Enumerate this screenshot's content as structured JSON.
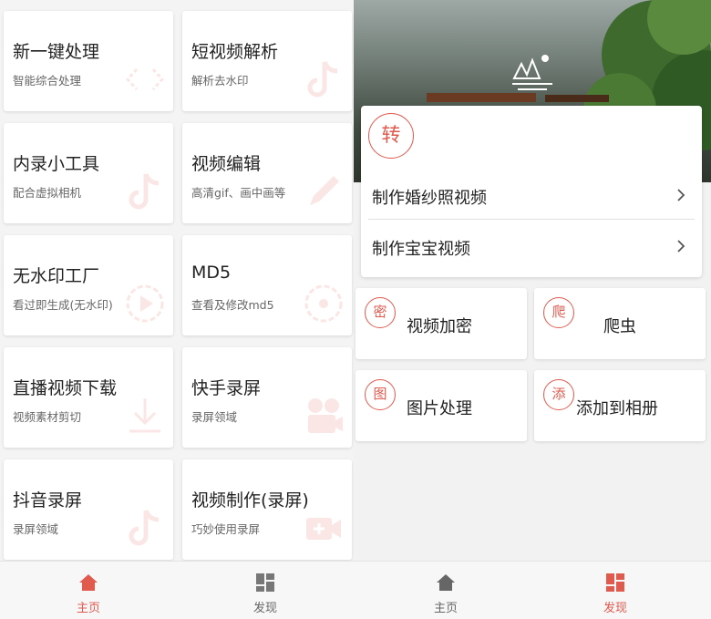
{
  "left": {
    "cards": [
      {
        "title": "新一键处理",
        "sub": "智能综合处理",
        "icon": "code-brackets-icon"
      },
      {
        "title": "短视频解析",
        "sub": "解析去水印",
        "icon": "tiktok-icon"
      },
      {
        "title": "内录小工具",
        "sub": "配合虚拟相机",
        "icon": "tiktok-icon"
      },
      {
        "title": "视频编辑",
        "sub": "高清gif、画中画等",
        "icon": "pencil-icon"
      },
      {
        "title": "无水印工厂",
        "sub": "看过即生成(无水印)",
        "icon": "play-circle-icon"
      },
      {
        "title": "MD5",
        "sub": "查看及修改md5",
        "icon": "target-icon"
      },
      {
        "title": "直播视频下载",
        "sub": "视频素材剪切",
        "icon": "download-icon"
      },
      {
        "title": "快手录屏",
        "sub": "录屏领域",
        "icon": "camera-reel-icon"
      },
      {
        "title": "抖音录屏",
        "sub": "录屏领域",
        "icon": "tiktok-icon"
      },
      {
        "title": "视频制作(录屏)",
        "sub": "巧妙使用录屏",
        "icon": "video-plus-icon"
      }
    ],
    "tabbar": {
      "home": "主页",
      "discover": "发现"
    }
  },
  "right": {
    "convert_badge": "转",
    "rows": [
      {
        "label": "制作婚纱照视频"
      },
      {
        "label": "制作宝宝视频"
      }
    ],
    "tools": [
      {
        "badge": "密",
        "label": "视频加密"
      },
      {
        "badge": "爬",
        "label": "爬虫"
      },
      {
        "badge": "图",
        "label": "图片处理"
      },
      {
        "badge": "添",
        "label": "添加到相册"
      }
    ],
    "tabbar": {
      "home": "主页",
      "discover": "发现"
    }
  },
  "colors": {
    "accent": "#e05a4e",
    "text": "#222222",
    "muted": "#666666",
    "bg": "#f2f2f2"
  }
}
